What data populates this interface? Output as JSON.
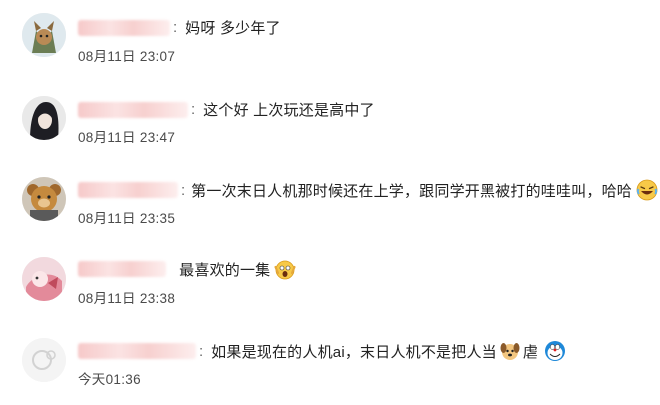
{
  "comments": [
    {
      "avatar": "fox-character-avatar",
      "text": "妈呀 多少年了",
      "time": "08月11日 23:07",
      "emoji": ""
    },
    {
      "avatar": "dark-haired-character-avatar",
      "text": "这个好 上次玩还是高中了",
      "time": "08月11日 23:47",
      "emoji": ""
    },
    {
      "avatar": "bear-character-avatar",
      "text": "第一次末日人机那时候还在上学，跟同学开黑被打的哇哇叫，哈哈",
      "time": "08月11日 23:35",
      "emoji": "laughing-tears-emoji"
    },
    {
      "avatar": "pink-anime-avatar",
      "text": "最喜欢的一集",
      "time": "08月11日 23:38",
      "emoji": "screaming-face-emoji"
    },
    {
      "avatar": "default-gray-avatar",
      "text": "如果是现在的人机ai，末日人机不是把人当",
      "text_suffix": "虐",
      "time": "今天01:36",
      "emoji": "dog-face-emoji",
      "emoji2": "doraemon-emoji"
    }
  ],
  "colors": {
    "name_blur": "#f6c9c9",
    "timestamp": "#4a4a4a",
    "text": "#222222"
  }
}
